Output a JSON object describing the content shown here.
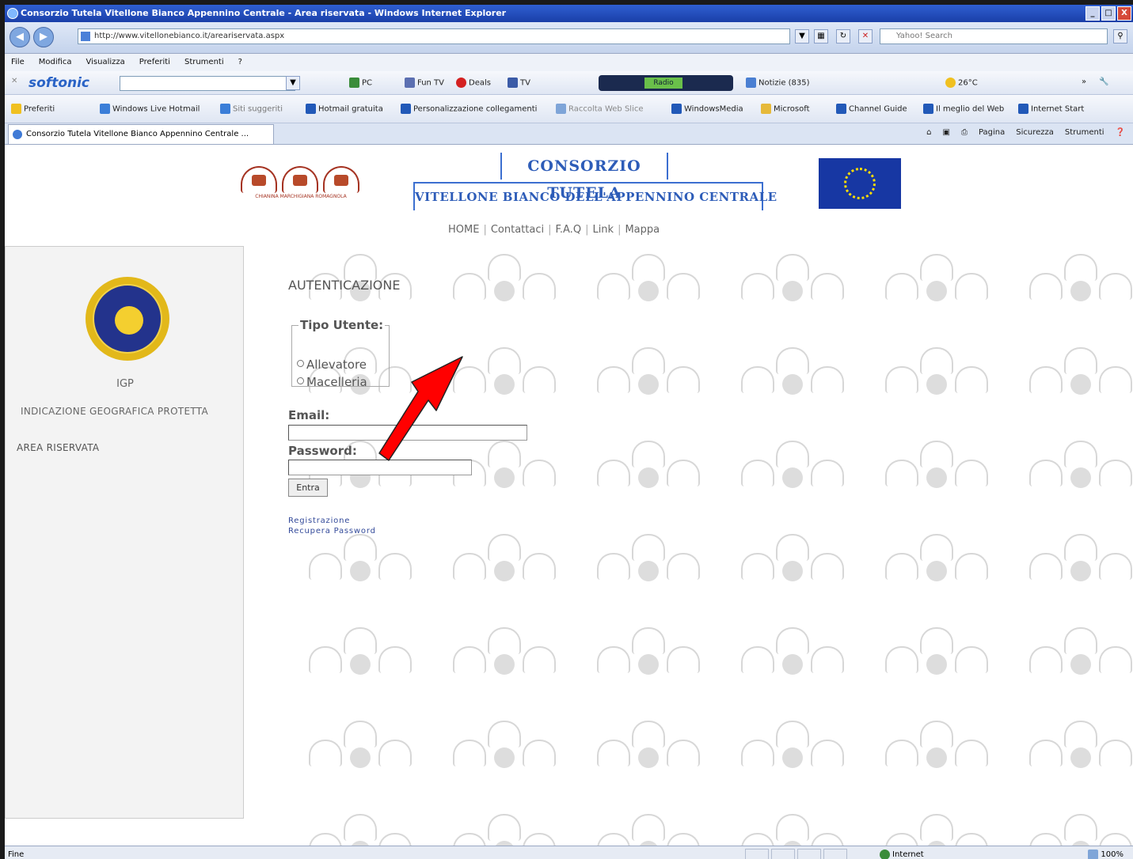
{
  "window": {
    "title": "Consorzio Tutela Vitellone Bianco Appennino Centrale - Area riservata - Windows Internet Explorer",
    "buttons": [
      "_",
      "□",
      "X"
    ]
  },
  "address": {
    "url": "http://www.vitellonebianco.it/areariservata.aspx",
    "search_placeholder": "Yahoo! Search"
  },
  "menu": [
    "File",
    "Modifica",
    "Visualizza",
    "Preferiti",
    "Strumenti",
    "?"
  ],
  "toolbar": {
    "brand": "softonic",
    "items": [
      "PC",
      "Fun TV",
      "Deals",
      "TV",
      "Notizie (835)",
      "26°C"
    ],
    "radio_label": "Radio"
  },
  "favorites": {
    "label": "Preferiti",
    "items": [
      "Windows Live Hotmail",
      "Siti suggeriti",
      "Hotmail gratuita",
      "Personalizzazione collegamenti",
      "Raccolta Web Slice",
      "WindowsMedia",
      "Microsoft",
      "Channel Guide",
      "Il meglio del Web",
      "Internet Start"
    ]
  },
  "tab": {
    "label": "Consorzio Tutela Vitellone Bianco Appennino Centrale ..."
  },
  "commands": [
    "Pagina",
    "Sicurezza",
    "Strumenti"
  ],
  "header": {
    "logos_caption": "CHIANINA MARCHIGIANA ROMAGNOLA",
    "title_top": "CONSORZIO TUTELA",
    "title_bottom": "VITELLONE BIANCO DELL'APPENNINO CENTRALE"
  },
  "nav": [
    "HOME",
    "Contattaci",
    "F.A.Q",
    "Link",
    "Mappa"
  ],
  "sidebar": {
    "igp": "IGP",
    "igp_full": "INDICAZIONE GEOGRAFICA PROTETTA",
    "area": "AREA RISERVATA"
  },
  "login": {
    "title": "AUTENTICAZIONE",
    "user_type_legend": "Tipo Utente:",
    "options": [
      "Allevatore",
      "Macelleria"
    ],
    "email_label": "Email:",
    "password_label": "Password:",
    "submit": "Entra",
    "links": [
      "Registrazione",
      "Recupera Password"
    ]
  },
  "status": {
    "left": "Fine",
    "zone": "Internet",
    "zoom": "100%"
  },
  "colors": {
    "accent_blue": "#2d5cb8",
    "arrow_red": "#ff0000"
  }
}
